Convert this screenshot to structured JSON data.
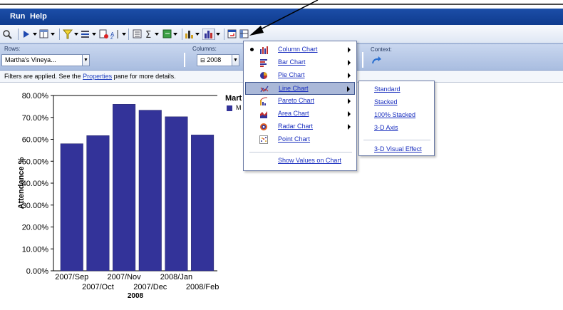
{
  "menubar": {
    "run": "Run",
    "help": "Help"
  },
  "filters": {
    "rows_label": "Rows:",
    "rows_value": "Martha's Vineya...",
    "columns_label": "Columns:",
    "columns_value": "2008",
    "context_label": "Context:"
  },
  "info": {
    "prefix": "Filters are applied. See the ",
    "link": "Properties",
    "suffix": " pane for more details."
  },
  "legend": {
    "title": "Mart",
    "entry": "M"
  },
  "chart_menu": {
    "items": [
      {
        "label": "Column Chart",
        "icon": "column-chart-icon",
        "checked": true,
        "submenu": true
      },
      {
        "label": "Bar Chart",
        "icon": "bar-chart-icon",
        "checked": false,
        "submenu": true
      },
      {
        "label": "Pie Chart",
        "icon": "pie-chart-icon",
        "checked": false,
        "submenu": true
      },
      {
        "label": "Line Chart",
        "icon": "line-chart-icon",
        "checked": false,
        "submenu": true,
        "highlighted": true
      },
      {
        "label": "Pareto Chart",
        "icon": "pareto-chart-icon",
        "checked": false,
        "submenu": true
      },
      {
        "label": "Area Chart",
        "icon": "area-chart-icon",
        "checked": false,
        "submenu": true
      },
      {
        "label": "Radar Chart",
        "icon": "radar-chart-icon",
        "checked": false,
        "submenu": true
      },
      {
        "label": "Point Chart",
        "icon": "point-chart-icon",
        "checked": false,
        "submenu": false
      }
    ],
    "show_values": "Show Values on Chart"
  },
  "line_submenu": {
    "items": [
      "Standard",
      "Stacked",
      "100% Stacked",
      "3-D Axis"
    ],
    "extra": "3-D Visual Effect"
  },
  "colors": {
    "bar": "#333399",
    "accent": "#0f3b8e"
  },
  "chart_data": {
    "type": "bar",
    "categories": [
      "2007/Sep",
      "2007/Oct",
      "2007/Nov",
      "2007/Dec",
      "2008/Jan",
      "2008/Feb"
    ],
    "values": [
      58.0,
      61.7,
      76.0,
      73.3,
      70.3,
      62.0
    ],
    "ylabel": "Attendance %",
    "xlabel": "2008",
    "ylim": [
      0,
      80
    ],
    "yticks": [
      "0.00%",
      "10.00%",
      "20.00%",
      "30.00%",
      "40.00%",
      "50.00%",
      "60.00%",
      "70.00%",
      "80.00%"
    ],
    "grid": false
  }
}
